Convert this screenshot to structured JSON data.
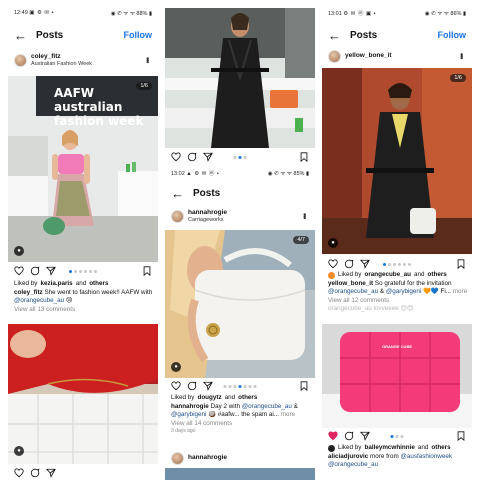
{
  "panel1": {
    "status": {
      "time": "12:49",
      "icons": "▣ ⚙ ✉ •",
      "right": "◉ ✆ ᯤ ᯤ 88% ▮"
    },
    "nav": {
      "back": "←",
      "title": "Posts",
      "follow": "Follow"
    },
    "user": {
      "name": "coley_fitz",
      "sub": "Australian Fashion Week"
    },
    "counter": "1/6",
    "post": {
      "liked_prefix": "Liked by",
      "liked_user": "kezia.paris",
      "liked_suffix": "and",
      "liked_others": "others",
      "author": "coley_fitz",
      "caption": "She went to fashion week!! AAFW with",
      "mention": "@orangecube_au",
      "emoji": "😢",
      "comments": "View all 13 comments"
    },
    "event_banner": "AAFW australian fashion week"
  },
  "panel2": {
    "status": {
      "time": "13:02",
      "icons": "▲ ⚙ ✉ ⓜ •",
      "right": "◉ ✆ ᯤ ᯤ 85% ▮"
    },
    "nav": {
      "back": "←",
      "title": "Posts"
    },
    "user": {
      "name": "hannahrogie",
      "sub": "Carriageworks"
    },
    "counter": "4/7",
    "post": {
      "liked_prefix": "Liked by",
      "liked_user": "dougytz",
      "liked_suffix": "and",
      "liked_others": "others",
      "author": "hannahrogie",
      "caption": "Day 2 with",
      "mention1": "@orangecube_au",
      "amp": "&",
      "mention2": "@garybigeni",
      "caption_tail": "🥥 #aafw... the spam ai...",
      "more": "more",
      "comments": "View all 14 comments",
      "date": "3 days ago"
    },
    "next_user": "hannahrogie"
  },
  "panel3": {
    "status": {
      "time": "13:01",
      "icons": "⚙ ✉ ⓜ ▣ •",
      "right": "◉ ✆ ᯤ ᯤ 86% ▮"
    },
    "nav": {
      "back": "←",
      "title": "Posts",
      "follow": "Follow"
    },
    "user": {
      "name": "yellow_bone_it"
    },
    "counter": "1/6",
    "post": {
      "liked_prefix": "Liked by",
      "liked_user": "orangecube_au",
      "liked_suffix": "and",
      "liked_others": "others",
      "author": "yellow_bone_it",
      "caption": "So grateful for the invitation",
      "mention1": "@orangecube_au",
      "amp": "&",
      "mention2": "@garybigeni",
      "caption_tail": "🧡💙 Fi...",
      "more": "more",
      "comments": "View all 12 comments",
      "faded": "orangecube_au  lovveeee 😍😍"
    },
    "post2": {
      "liked_prefix": "Liked by",
      "liked_user": "balleymcwhinnie",
      "liked_suffix": "and",
      "liked_others": "others",
      "author": "aliciadjurovic",
      "caption": "more from",
      "mention1": "@ausfashionweek",
      "mention2": "@orangecube_au"
    },
    "bag_brand": "ORANGE CUBE"
  },
  "colors": {
    "link": "#1d4e89",
    "follow": "#1a73e8",
    "heart": "#e0245e",
    "pink_bag": "#f23b78"
  }
}
